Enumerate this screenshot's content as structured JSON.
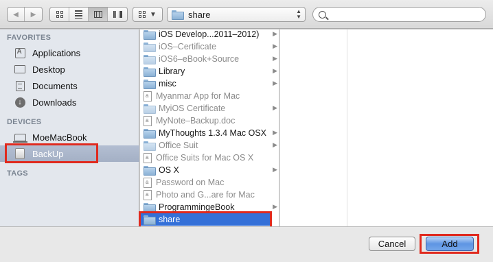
{
  "toolbar": {
    "path_label": "share",
    "search_value": "",
    "search_placeholder": ""
  },
  "sidebar": {
    "favorites_heading": "FAVORITES",
    "devices_heading": "DEVICES",
    "tags_heading": "TAGS",
    "favorites": [
      {
        "label": "Applications",
        "icon": "applications-icon"
      },
      {
        "label": "Desktop",
        "icon": "desktop-icon"
      },
      {
        "label": "Documents",
        "icon": "documents-icon"
      },
      {
        "label": "Downloads",
        "icon": "downloads-icon"
      }
    ],
    "devices": [
      {
        "label": "MoeMacBook",
        "icon": "laptop-icon"
      },
      {
        "label": "BackUp",
        "icon": "external-drive-icon",
        "selected": true
      }
    ]
  },
  "files": [
    {
      "name": "iOS Develop...2011–2012)",
      "kind": "folder",
      "dim": false,
      "chevron": true
    },
    {
      "name": "iOS–Certificate",
      "kind": "folder",
      "dim": true,
      "chevron": true
    },
    {
      "name": "iOS6–eBook+Source",
      "kind": "folder",
      "dim": true,
      "chevron": true
    },
    {
      "name": "Library",
      "kind": "folder",
      "dim": false,
      "chevron": true
    },
    {
      "name": "misc",
      "kind": "folder",
      "dim": false,
      "chevron": true
    },
    {
      "name": "Myanmar App for Mac",
      "kind": "document",
      "dim": true,
      "chevron": false
    },
    {
      "name": "MyiOS Certificate",
      "kind": "folder",
      "dim": true,
      "chevron": true
    },
    {
      "name": "MyNote–Backup.doc",
      "kind": "document",
      "dim": true,
      "chevron": false
    },
    {
      "name": "MyThoughts 1.3.4 Mac OSX",
      "kind": "folder",
      "dim": false,
      "chevron": true
    },
    {
      "name": "Office Suit",
      "kind": "folder",
      "dim": true,
      "chevron": true
    },
    {
      "name": "Office Suits for Mac OS X",
      "kind": "document",
      "dim": true,
      "chevron": false
    },
    {
      "name": "OS X",
      "kind": "folder",
      "dim": false,
      "chevron": true
    },
    {
      "name": "Password on Mac",
      "kind": "document",
      "dim": true,
      "chevron": false
    },
    {
      "name": "Photo and G...are for Mac",
      "kind": "document",
      "dim": true,
      "chevron": false
    },
    {
      "name": "ProgrammingeBook",
      "kind": "folder",
      "dim": false,
      "chevron": true
    },
    {
      "name": "share",
      "kind": "folder",
      "dim": false,
      "chevron": true,
      "selected": true
    }
  ],
  "buttons": {
    "cancel": "Cancel",
    "add": "Add"
  },
  "colors": {
    "selection": "#3470d8",
    "highlight_box": "#e02a1e",
    "sidebar_bg": "#e3e7ed"
  }
}
